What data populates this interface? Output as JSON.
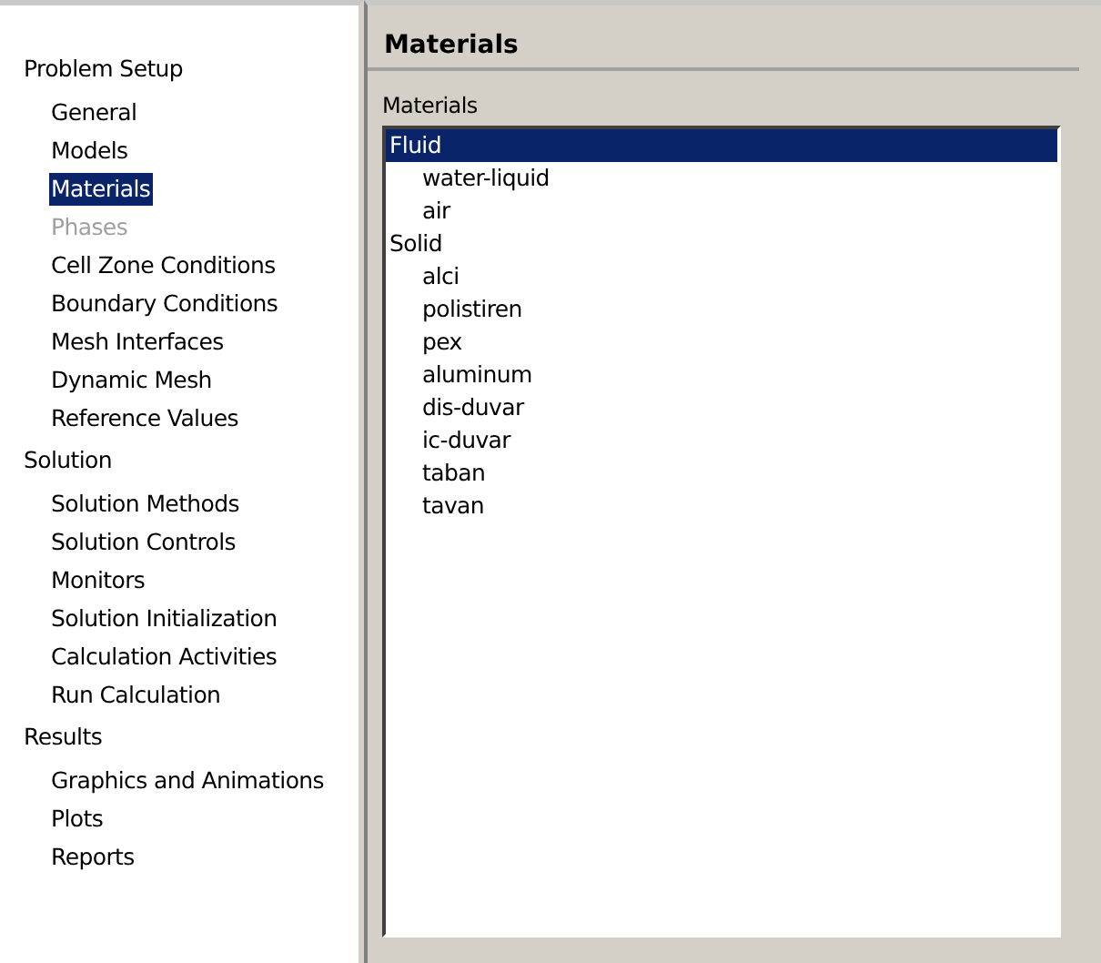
{
  "navigation": [
    {
      "title": "Problem Setup",
      "items": [
        {
          "label": "General",
          "selected": false,
          "disabled": false
        },
        {
          "label": "Models",
          "selected": false,
          "disabled": false
        },
        {
          "label": "Materials",
          "selected": true,
          "disabled": false
        },
        {
          "label": "Phases",
          "selected": false,
          "disabled": true
        },
        {
          "label": "Cell Zone Conditions",
          "selected": false,
          "disabled": false
        },
        {
          "label": "Boundary Conditions",
          "selected": false,
          "disabled": false
        },
        {
          "label": "Mesh Interfaces",
          "selected": false,
          "disabled": false
        },
        {
          "label": "Dynamic Mesh",
          "selected": false,
          "disabled": false
        },
        {
          "label": "Reference Values",
          "selected": false,
          "disabled": false
        }
      ]
    },
    {
      "title": "Solution",
      "items": [
        {
          "label": "Solution Methods",
          "selected": false,
          "disabled": false
        },
        {
          "label": "Solution Controls",
          "selected": false,
          "disabled": false
        },
        {
          "label": "Monitors",
          "selected": false,
          "disabled": false
        },
        {
          "label": "Solution Initialization",
          "selected": false,
          "disabled": false
        },
        {
          "label": "Calculation Activities",
          "selected": false,
          "disabled": false
        },
        {
          "label": "Run Calculation",
          "selected": false,
          "disabled": false
        }
      ]
    },
    {
      "title": "Results",
      "items": [
        {
          "label": "Graphics and Animations",
          "selected": false,
          "disabled": false
        },
        {
          "label": "Plots",
          "selected": false,
          "disabled": false
        },
        {
          "label": "Reports",
          "selected": false,
          "disabled": false
        }
      ]
    }
  ],
  "panel": {
    "title": "Materials",
    "list_label": "Materials",
    "materials": [
      {
        "label": "Fluid",
        "selected": true,
        "children": [
          {
            "label": "water-liquid",
            "selected": false
          },
          {
            "label": "air",
            "selected": false
          }
        ]
      },
      {
        "label": "Solid",
        "selected": false,
        "children": [
          {
            "label": "alci",
            "selected": false
          },
          {
            "label": "polistiren",
            "selected": false
          },
          {
            "label": "pex",
            "selected": false
          },
          {
            "label": "aluminum",
            "selected": false
          },
          {
            "label": "dis-duvar",
            "selected": false
          },
          {
            "label": "ic-duvar",
            "selected": false
          },
          {
            "label": "taban",
            "selected": false
          },
          {
            "label": "tavan",
            "selected": false
          }
        ]
      }
    ]
  }
}
